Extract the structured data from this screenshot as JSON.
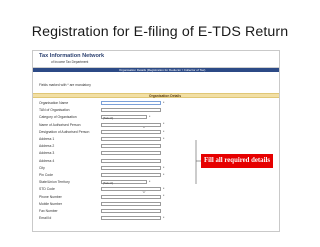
{
  "slide": {
    "title": "Registration for E-filing of E-TDS Return"
  },
  "tin": {
    "title": "Tax Information Network",
    "subtitle": "of Income Tax Department",
    "banner": "Organisation Details (Registration for Deductor / Collector of Tax)",
    "mandatory_note": "Fields marked with * are mandatory"
  },
  "section": {
    "title": "Organisation Details"
  },
  "fields": [
    {
      "label": "Organisation Name",
      "type": "text",
      "required": true
    },
    {
      "label": "TAN of Organisation",
      "type": "text",
      "required": false
    },
    {
      "label": "Category of Organisation",
      "type": "select",
      "value": "[Select]",
      "required": true
    },
    {
      "label": "Name of Authorised Person",
      "type": "text",
      "required": true
    },
    {
      "label": "Designation of Authorised Person",
      "type": "text",
      "required": true
    },
    {
      "label": "Address 1",
      "type": "text",
      "required": true
    },
    {
      "label": "Address 2",
      "type": "text",
      "required": false
    },
    {
      "label": "Address 3",
      "type": "text",
      "required": false
    },
    {
      "label": "Address 4",
      "type": "text",
      "required": false
    },
    {
      "label": "City",
      "type": "text",
      "required": true
    },
    {
      "label": "Pin Code",
      "type": "text",
      "required": true
    },
    {
      "label": "State/Union Territory",
      "type": "select",
      "value": "[Select]",
      "required": true
    },
    {
      "label": "STD Code",
      "type": "text",
      "required": true
    },
    {
      "label": "Phone Number",
      "type": "text",
      "required": true
    },
    {
      "label": "Mobile Number",
      "type": "text",
      "required": false
    },
    {
      "label": "Fax Number",
      "type": "text",
      "required": false
    },
    {
      "label": "Email Id",
      "type": "text",
      "required": true
    }
  ],
  "callout": {
    "text": "Fill all required details",
    "color": "#e60000"
  },
  "colors": {
    "banner": "#2c4a86",
    "section_bar": "#f2dfa4"
  }
}
